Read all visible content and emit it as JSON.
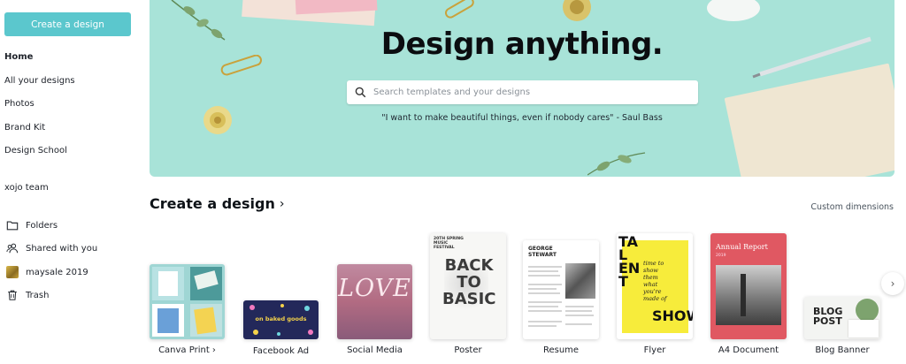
{
  "sidebar": {
    "create_button": "Create a design",
    "items": [
      {
        "label": "Home"
      },
      {
        "label": "All your designs"
      },
      {
        "label": "Photos"
      },
      {
        "label": "Brand Kit"
      },
      {
        "label": "Design School"
      }
    ],
    "team": "xojo team",
    "folders": [
      {
        "label": "Folders",
        "icon": "folder-icon"
      },
      {
        "label": "Shared with you",
        "icon": "people-icon"
      },
      {
        "label": "maysale 2019",
        "icon": "folder-thumbnail-icon"
      },
      {
        "label": "Trash",
        "icon": "trash-icon"
      }
    ]
  },
  "hero": {
    "title": "Design anything.",
    "search_placeholder": "Search templates and your designs",
    "quote": "\"I want to make beautiful things, even if nobody cares\" - Saul Bass",
    "background": "#a8e3d8"
  },
  "section": {
    "title": "Create a design",
    "custom_dimensions": "Custom dimensions"
  },
  "cards": [
    {
      "label": "Canva Print ›"
    },
    {
      "label": "Facebook Ad",
      "text": "on baked goods"
    },
    {
      "label": "Social Media",
      "text": "LOVE"
    },
    {
      "label": "Poster",
      "text_top": "20TH SPRING MUSIC FESTIVAL",
      "text": "BACK TO BASIC"
    },
    {
      "label": "Resume",
      "text": "GEORGE STEWART"
    },
    {
      "label": "Flyer",
      "text_a": "TAL ENT",
      "text_b": "time to show them what you're made of",
      "text_c": "SHOW"
    },
    {
      "label": "A4 Document",
      "text": "Annual Report",
      "sub": "2019"
    },
    {
      "label": "Blog Banner",
      "text": "BLOG POST"
    }
  ],
  "colors": {
    "accent": "#5bc7cd",
    "flyer_yellow": "#f7ec3b",
    "report_red": "#e05862"
  }
}
